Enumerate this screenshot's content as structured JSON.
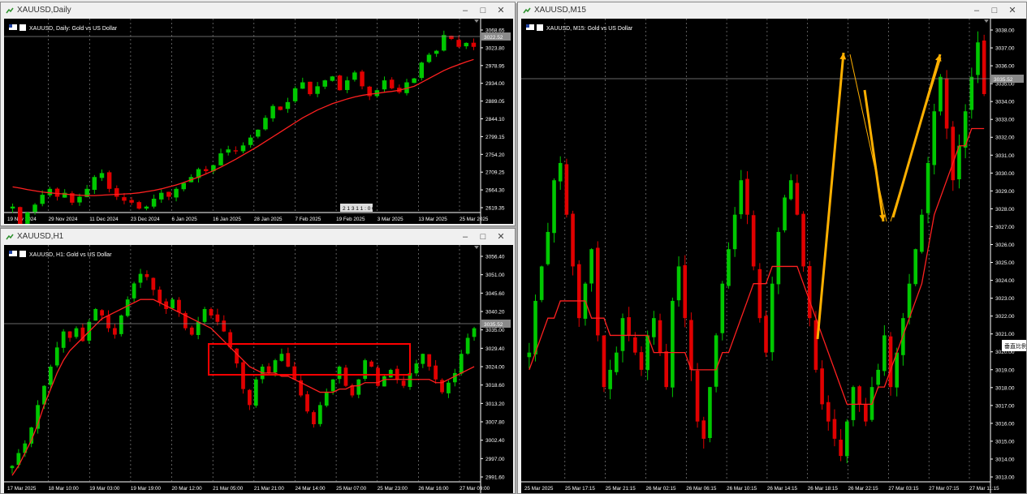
{
  "palette": {
    "bull": "#00c800",
    "bear": "#e00000",
    "ma": "#ff2020",
    "grid": "#9a9a9a",
    "axis": "#ffffff",
    "box": "#ff0000",
    "arrow": "#ffb000",
    "bg": "#000000",
    "fg": "#ffffff"
  },
  "windows": {
    "daily": {
      "title": "XAUUSD,Daily",
      "label": "XAUUSD, Daily:  Gold vs US Dollar",
      "price_tag": "3022.52",
      "mini_label": "2 1 3 1 1 : 0 0",
      "yticks": [
        "3068.65",
        "3023.80",
        "2978.95",
        "2934.00",
        "2889.05",
        "2844.10",
        "2799.15",
        "2754.20",
        "2709.25",
        "2664.30",
        "2619.35"
      ],
      "xticks": [
        "19 Nov 2024",
        "29 Nov 2024",
        "11 Dec 2024",
        "23 Dec 2024",
        "6 Jan 2025",
        "16 Jan 2025",
        "28 Jan 2025",
        "7 Feb 2025",
        "19 Feb 2025",
        "3 Mar 2025",
        "13 Mar 2025",
        "25 Mar 2025"
      ]
    },
    "h1": {
      "title": "XAUUSD,H1",
      "label": "XAUUSD, H1:  Gold vs US Dollar",
      "price_tag": "3035.52",
      "yticks": [
        "3056.40",
        "3051.00",
        "3045.60",
        "3040.20",
        "3035.00",
        "3029.40",
        "3024.00",
        "3018.60",
        "3013.20",
        "3007.80",
        "3002.40",
        "2997.00",
        "2991.60"
      ],
      "xticks": [
        "17 Mar 2025",
        "18 Mar 10:00",
        "19 Mar 03:00",
        "19 Mar 19:00",
        "20 Mar 12:00",
        "21 Mar 05:00",
        "21 Mar 21:00",
        "24 Mar 14:00",
        "25 Mar 07:00",
        "25 Mar 23:00",
        "26 Mar 16:00",
        "27 Mar 09:00"
      ]
    },
    "m15": {
      "title": "XAUUSD,M15",
      "label": "XAUUSD, M15:  Gold vs US Dollar",
      "price_tag": "3035.52",
      "side_tag": "垂直比例",
      "yticks": [
        "3038.00",
        "3037.00",
        "3036.00",
        "3035.00",
        "3034.00",
        "3033.00",
        "3032.00",
        "3031.00",
        "3030.00",
        "3029.00",
        "3028.00",
        "3027.00",
        "3026.00",
        "3025.00",
        "3024.00",
        "3023.00",
        "3022.00",
        "3021.00",
        "3020.00",
        "3019.00",
        "3018.00",
        "3017.00",
        "3016.00",
        "3015.00",
        "3014.00",
        "3013.00"
      ],
      "xticks": [
        "25 Mar 2025",
        "25 Mar 17:15",
        "25 Mar 21:15",
        "26 Mar 02:15",
        "26 Mar 06:15",
        "26 Mar 10:15",
        "26 Mar 14:15",
        "26 Mar 18:15",
        "26 Mar 22:15",
        "27 Mar 03:15",
        "27 Mar 07:15",
        "27 Mar 11:15"
      ]
    }
  },
  "chart_data": [
    {
      "type": "candlestick",
      "name": "XAUUSD Daily",
      "ylim": [
        2600,
        3075
      ],
      "close_series": [
        2615,
        2570,
        2600,
        2620,
        2645,
        2660,
        2640,
        2650,
        2625,
        2640,
        2660,
        2690,
        2700,
        2660,
        2640,
        2630,
        2625,
        2610,
        2615,
        2635,
        2650,
        2640,
        2660,
        2675,
        2690,
        2710,
        2705,
        2720,
        2750,
        2760,
        2755,
        2770,
        2790,
        2810,
        2840,
        2870,
        2860,
        2880,
        2915,
        2930,
        2900,
        2920,
        2935,
        2945,
        2910,
        2935,
        2955,
        2920,
        2895,
        2910,
        2935,
        2915,
        2905,
        2930,
        2940,
        2980,
        3000,
        3010,
        3050,
        3040,
        3020,
        3030,
        3020
      ],
      "ma_series": [
        2665,
        2662,
        2658,
        2655,
        2652,
        2650,
        2648,
        2647,
        2645,
        2644,
        2643,
        2643,
        2644,
        2645,
        2646,
        2647,
        2648,
        2650,
        2653,
        2656,
        2660,
        2665,
        2670,
        2676,
        2683,
        2690,
        2698,
        2706,
        2715,
        2725,
        2735,
        2746,
        2757,
        2768,
        2780,
        2792,
        2804,
        2816,
        2828,
        2840,
        2850,
        2860,
        2868,
        2876,
        2882,
        2888,
        2893,
        2897,
        2900,
        2902,
        2905,
        2907,
        2910,
        2915,
        2920,
        2930,
        2940,
        2950,
        2960,
        2968,
        2975,
        2982,
        2988
      ]
    },
    {
      "type": "candlestick",
      "name": "XAUUSD H1",
      "ylim": [
        2988,
        3060
      ],
      "close_series": [
        2993,
        2997,
        3000,
        3005,
        3012,
        3018,
        3024,
        3030,
        3035,
        3033,
        3036,
        3032,
        3038,
        3042,
        3040,
        3036,
        3034,
        3040,
        3045,
        3050,
        3053,
        3052,
        3048,
        3044,
        3042,
        3045,
        3041,
        3036,
        3034,
        3038,
        3042,
        3040,
        3038,
        3035,
        3030,
        3025,
        3017,
        3012,
        3020,
        3024,
        3022,
        3026,
        3028,
        3024,
        3020,
        3015,
        3010,
        3006,
        3012,
        3016,
        3020,
        3024,
        3018,
        3015,
        3020,
        3026,
        3024,
        3018,
        3021,
        3023,
        3020,
        3018,
        3022,
        3025,
        3028,
        3024,
        3020,
        3016,
        3019,
        3022,
        3028,
        3033,
        3036
      ],
      "ma_series": [
        2990,
        2993,
        2997,
        3001,
        3006,
        3012,
        3017,
        3022,
        3026,
        3029,
        3031,
        3033,
        3035,
        3037,
        3039,
        3040,
        3041,
        3042,
        3043,
        3044,
        3045,
        3045,
        3045,
        3044,
        3043,
        3042,
        3041,
        3040,
        3039,
        3038,
        3037,
        3036,
        3034,
        3032,
        3030,
        3028,
        3026,
        3024,
        3023,
        3022,
        3022,
        3022,
        3021,
        3021,
        3020,
        3019,
        3018,
        3017,
        3016,
        3016,
        3016,
        3017,
        3017,
        3018,
        3018,
        3019,
        3019,
        3019,
        3020,
        3020,
        3020,
        3020,
        3020,
        3020,
        3020,
        3020,
        3019,
        3019,
        3020,
        3021,
        3022,
        3023,
        3024
      ]
    },
    {
      "type": "candlestick",
      "name": "XAUUSD M15",
      "ylim": [
        3012.5,
        3039
      ],
      "close_series": [
        3020,
        3023,
        3025,
        3027,
        3030,
        3031,
        3028,
        3025,
        3022,
        3024,
        3026,
        3021,
        3018,
        3019,
        3020,
        3022,
        3021,
        3020,
        3019,
        3021,
        3022,
        3020,
        3018,
        3023,
        3025,
        3022,
        3019,
        3016,
        3015,
        3018,
        3021,
        3024,
        3026,
        3028,
        3030,
        3028,
        3025,
        3022,
        3020,
        3024,
        3027,
        3029,
        3030,
        3028,
        3025,
        3022,
        3019,
        3017,
        3016,
        3015,
        3014,
        3016,
        3018,
        3017,
        3016,
        3018,
        3019,
        3021,
        3018,
        3020,
        3022,
        3024,
        3026,
        3028,
        3031,
        3034,
        3036,
        3033,
        3030,
        3032,
        3034,
        3036,
        3038,
        3035
      ],
      "ma_series": [
        3019,
        3020,
        3021,
        3022,
        3022,
        3023,
        3023,
        3023,
        3023,
        3023,
        3022,
        3022,
        3022,
        3021,
        3021,
        3021,
        3021,
        3021,
        3021,
        3021,
        3020,
        3020,
        3020,
        3020,
        3020,
        3020,
        3019,
        3019,
        3019,
        3019,
        3019,
        3020,
        3020,
        3021,
        3022,
        3023,
        3024,
        3024,
        3024,
        3025,
        3025,
        3025,
        3025,
        3025,
        3024,
        3023,
        3022,
        3021,
        3020,
        3019,
        3018,
        3017,
        3017,
        3017,
        3017,
        3017,
        3018,
        3018,
        3019,
        3020,
        3021,
        3022,
        3023,
        3024,
        3026,
        3028,
        3029,
        3030,
        3031,
        3032,
        3032,
        3033,
        3033,
        3033
      ]
    }
  ]
}
